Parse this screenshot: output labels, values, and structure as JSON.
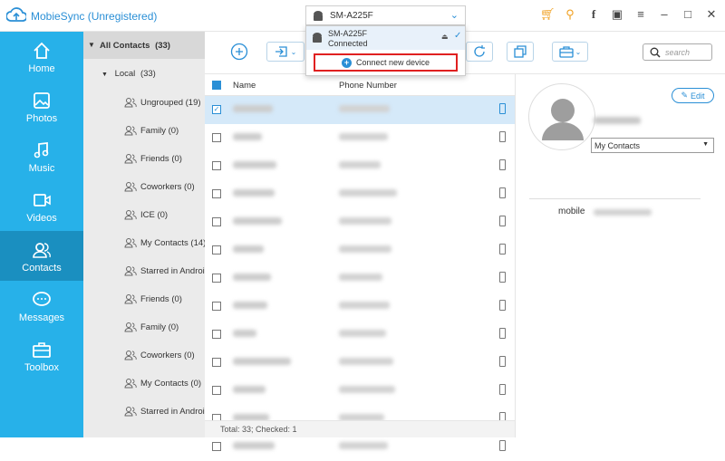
{
  "app": {
    "title": "MobieSync (Unregistered)"
  },
  "device": {
    "name": "SM-A225F",
    "status": "Connected",
    "connect_label": "Connect new device"
  },
  "nav": [
    {
      "label": "Home",
      "icon": "home-icon"
    },
    {
      "label": "Photos",
      "icon": "photos-icon"
    },
    {
      "label": "Music",
      "icon": "music-icon"
    },
    {
      "label": "Videos",
      "icon": "videos-icon"
    },
    {
      "label": "Contacts",
      "icon": "contacts-icon",
      "active": true
    },
    {
      "label": "Messages",
      "icon": "messages-icon"
    },
    {
      "label": "Toolbox",
      "icon": "toolbox-icon"
    }
  ],
  "tree": {
    "all": "All Contacts",
    "all_count": "(33)",
    "local": "Local",
    "local_count": "(33)",
    "groups": [
      "Ungrouped  (19)",
      "Family  (0)",
      "Friends  (0)",
      "Coworkers  (0)",
      "ICE  (0)",
      "My Contacts  (14)",
      "Starred in Android",
      "Friends  (0)",
      "Family  (0)",
      "Coworkers  (0)",
      "My Contacts  (0)",
      "Starred in Android"
    ]
  },
  "search": {
    "placeholder": "search"
  },
  "list": {
    "col_name": "Name",
    "col_phone": "Phone Number"
  },
  "footer": {
    "text": "Total: 33; Checked: 1"
  },
  "detail": {
    "edit_label": "Edit",
    "group_select": "My Contacts",
    "mobile_label": "mobile"
  },
  "colors": {
    "accent": "#2a8fd6",
    "sidebar": "#27b1e9",
    "sidebar_active": "#1a8fc0",
    "highlight": "#e02020"
  }
}
